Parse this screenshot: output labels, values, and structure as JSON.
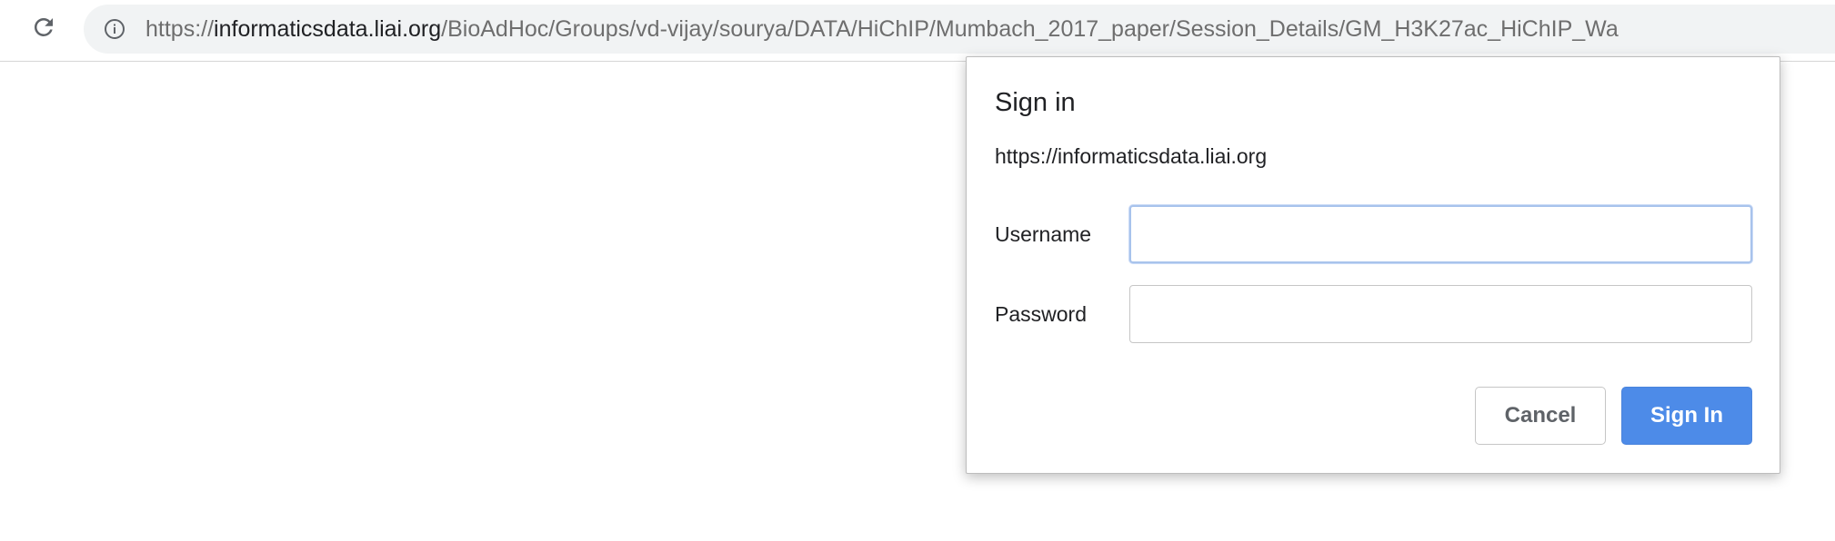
{
  "toolbar": {
    "reload_icon": "reload-icon",
    "address_bar": {
      "info_icon": "info-icon",
      "url_scheme": "https://",
      "url_host": "informaticsdata.liai.org",
      "url_path": "/BioAdHoc/Groups/vd-vijay/sourya/DATA/HiChIP/Mumbach_2017_paper/Session_Details/GM_H3K27ac_HiChIP_Wa"
    }
  },
  "dialog": {
    "title": "Sign in",
    "origin": "https://informaticsdata.liai.org",
    "username_label": "Username",
    "username_value": "",
    "password_label": "Password",
    "password_value": "",
    "cancel_label": "Cancel",
    "signin_label": "Sign In"
  },
  "colors": {
    "accent": "#4d8be8",
    "focus_ring": "#a8c3ec",
    "omnibox_bg": "#f1f3f4"
  }
}
